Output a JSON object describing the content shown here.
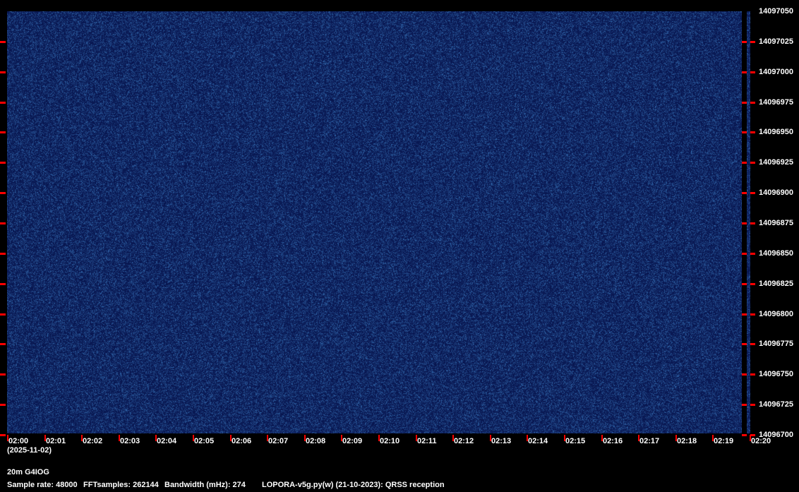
{
  "chart_data": {
    "type": "heatmap",
    "title": "",
    "x_ticks": [
      "02:00",
      "02:01",
      "02:02",
      "02:03",
      "02:04",
      "02:05",
      "02:06",
      "02:07",
      "02:08",
      "02:09",
      "02:10",
      "02:11",
      "02:12",
      "02:13",
      "02:14",
      "02:15",
      "02:16",
      "02:17",
      "02:18",
      "02:19",
      "02:20"
    ],
    "x_date": "(2025-11-02)",
    "y_ticks": [
      "14097050",
      "14097025",
      "14097000",
      "14096975",
      "14096950",
      "14096925",
      "14096900",
      "14096875",
      "14096850",
      "14096825",
      "14096800",
      "14096775",
      "14096750",
      "14096725",
      "14096700"
    ],
    "ylim": [
      14096700,
      14097050
    ],
    "colormap": {
      "background": "#0a1a5a",
      "noise": "#1e3c8c",
      "peak": "#9ad0ff"
    },
    "tick_color": "#ff0000"
  },
  "footer": {
    "station": "20m G4IOG",
    "sample_rate": "Sample rate: 48000",
    "fft_samples": "FFTsamples: 262144",
    "bandwidth": "Bandwidth (mHz): 274",
    "software": "LOPORA-v5g.py(w) (21-10-2023): QRSS reception"
  }
}
